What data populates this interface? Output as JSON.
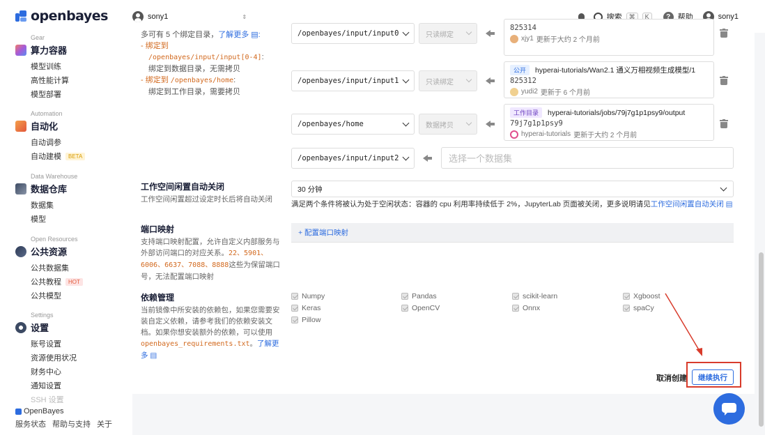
{
  "brand": {
    "name": "openbayes"
  },
  "topbar": {
    "workspace": "sony1",
    "search_label": "搜索",
    "kbd_cmd": "⌘",
    "kbd_k": "K",
    "help_label": "帮助",
    "user": "sony1"
  },
  "sidebar": {
    "groups": [
      {
        "eyebrow": "Gear",
        "title": "算力容器",
        "items": [
          "模型训练",
          "高性能计算",
          "模型部署"
        ]
      },
      {
        "eyebrow": "Automation",
        "title": "自动化",
        "items": [
          "自动调参",
          "自动建模"
        ],
        "badge": "BETA"
      },
      {
        "eyebrow": "Data Warehouse",
        "title": "数据仓库",
        "items": [
          "数据集",
          "模型"
        ]
      },
      {
        "eyebrow": "Open Resources",
        "title": "公共资源",
        "items": [
          "公共数据集",
          "公共教程",
          "公共模型"
        ],
        "badge": "HOT"
      },
      {
        "eyebrow": "Settings",
        "title": "设置",
        "items": [
          "账号设置",
          "资源使用状况",
          "财务中心",
          "通知设置",
          "SSH 设置"
        ]
      }
    ],
    "footer": {
      "brand": "OpenBayes",
      "links": [
        "服务状态",
        "帮助与支持",
        "关于"
      ]
    }
  },
  "mount": {
    "intro_text": "多可有 5 个绑定目录，",
    "intro_link": "了解更多",
    "bullet1_label": "绑定到",
    "bullet1_path": "/openbayes/input/input[0-4]",
    "bullet1_desc": "绑定到数据目录，无需拷贝",
    "bullet2_label": "绑定到",
    "bullet2_path": "/openbayes/home",
    "bullet2_desc": "绑定到工作目录，需要拷贝",
    "rows": [
      {
        "dir": "/openbayes/input/input0",
        "mode": "只读绑定",
        "tag": "",
        "title": "",
        "id": "825314",
        "user": "xjy1",
        "updated": "更新于大约 2 个月前"
      },
      {
        "dir": "/openbayes/input/input1",
        "mode": "只读绑定",
        "tag": "公开",
        "title": "hyperai-tutorials/Wan2.1 通义万相视频生成模型/1",
        "id": "825312",
        "user": "yudi2",
        "updated": "更新于 6 个月前"
      },
      {
        "dir": "/openbayes/home",
        "mode": "数据拷贝",
        "tag": "工作目录",
        "title": "hyperai-tutorials/jobs/79j7g1p1psy9/output",
        "id": "79j7g1p1psy9",
        "user": "hyperai-tutorials",
        "updated": "更新于大约 2 个月前"
      }
    ],
    "empty_row": {
      "dir": "/openbayes/input/input2",
      "placeholder": "选择一个数据集"
    }
  },
  "idle": {
    "title": "工作空间闲置自动关闭",
    "desc": "工作空间闲置超过设定时长后将自动关闭",
    "value": "30 分钟",
    "note": "满足两个条件将被认为处于空闲状态：容器的 cpu 利用率持续低于 2%，JupyterLab 页面被关闭，更多说明请见",
    "note_link": "工作空间闲置自动关闭"
  },
  "ports": {
    "title": "端口映射",
    "desc1": "支持端口映射配置，允许自定义内部服务与外部访问端口的对应关系。",
    "reserved": "22、5901、6006、6637、7088、8888",
    "desc2": "这些为保留端口号，无法配置端口映射",
    "button": "+ 配置端口映射"
  },
  "deps": {
    "title": "依赖管理",
    "desc1": "当前镜像中所安装的依赖包，如果您需要安装自定义依赖，请参考我们的依赖安装文档。如果你想安装额外的依赖，可以使用",
    "file": "openbayes_requirements.txt",
    "desc_link": "了解更多",
    "packages": [
      "Numpy",
      "Pandas",
      "scikit-learn",
      "Xgboost",
      "Keras",
      "OpenCV",
      "Onnx",
      "spaCy",
      "Pillow"
    ]
  },
  "actions": {
    "cancel": "取消创建",
    "continue": "继续执行"
  },
  "colors": {
    "accent": "#2d6cdf",
    "highlight": "#d83b2b",
    "reserved": "#d2691e"
  }
}
